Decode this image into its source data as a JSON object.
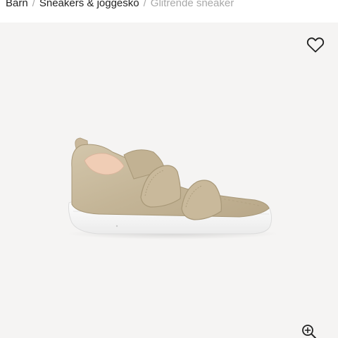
{
  "breadcrumb": {
    "items": [
      {
        "label": "Barn"
      },
      {
        "label": "Sneakers & joggesko"
      }
    ],
    "separator": "/",
    "current": "Glitrende sneaker"
  },
  "product": {
    "icons": {
      "wishlist": "heart-outline-icon",
      "zoom": "zoom-in-icon"
    }
  },
  "colors": {
    "image_background": "#f5f4f3",
    "breadcrumb_current": "#a8a8a8",
    "shoe_upper": "#c7b89c",
    "shoe_sole": "#ffffff",
    "shoe_lining": "#f0cdb5"
  }
}
